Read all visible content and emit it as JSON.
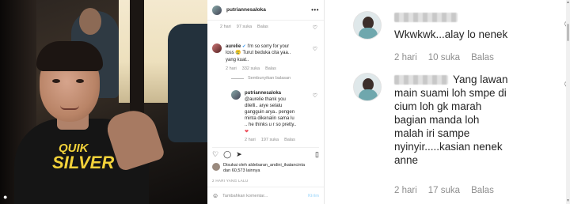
{
  "photo": {
    "shirt_logo_line1": "QUIK",
    "shirt_logo_line2": "SILVER",
    "logo_color": "#f2d23a"
  },
  "ig": {
    "username": "putriannesaloka",
    "more_label": "•••",
    "first_meta": {
      "time": "2 hari",
      "likes": "97 suka",
      "reply": "Balas"
    },
    "comment_aurelie": {
      "user": "aurelie",
      "verified": "✔",
      "text_line1": "I'm so sorry for your",
      "text_line2": "loss 😢 Turut beduka cita yaa..",
      "text_line3": "yang kuat..",
      "time": "2 hari",
      "likes": "332 suka",
      "reply": "Balas"
    },
    "hide_replies": "Sembunyikan balasan",
    "reply_putri": {
      "user": "putriannesaloka",
      "text_line1": "@aurelie thank you",
      "text_line2": "dilelli.. arye selalu",
      "text_line3": "gangguin arya.. pengen",
      "text_line4": "minta dikenalin sama lu",
      "text_line5": ".. he thinks u r so pretty..",
      "text_line6": "❤",
      "time": "2 hari",
      "likes": "197 suka",
      "reply": "Balas"
    },
    "liked_by_line1": "Disukai oleh aldebaran_andini_ikatancinta",
    "liked_by_line2": "dan 60,573 lainnya",
    "ago": "2 HARI YANG LALU",
    "add_comment_placeholder": "Tambahkan komentar...",
    "post_label": "Kirim"
  },
  "right": {
    "comment1": {
      "text": "Wkwkwk...alay lo nenek",
      "time": "2 hari",
      "likes": "10 suka",
      "reply": "Balas"
    },
    "comment2": {
      "text_line1": "Yang lawan",
      "text_line2": "main suami loh smpe di",
      "text_line3": "cium loh gk marah",
      "text_line4": "bagian manda loh",
      "text_line5": "malah iri sampe",
      "text_line6": "nyinyir.....kasian nenek",
      "text_line7": "anne",
      "time": "2 hari",
      "likes": "17 suka",
      "reply": "Balas"
    }
  },
  "icons": {
    "heart": "heart-icon",
    "comment": "comment-icon",
    "share": "share-icon",
    "bookmark": "bookmark-icon",
    "emoji": "emoji-icon"
  }
}
